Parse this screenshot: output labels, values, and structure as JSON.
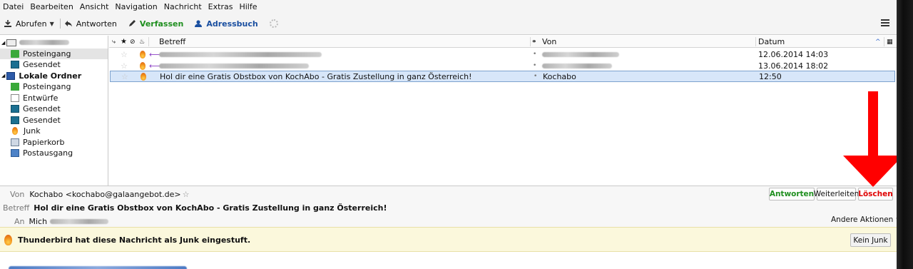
{
  "menubar": [
    "Datei",
    "Bearbeiten",
    "Ansicht",
    "Navigation",
    "Nachricht",
    "Extras",
    "Hilfe"
  ],
  "toolbar": {
    "get": "Abrufen",
    "reply": "Antworten",
    "compose": "Verfassen",
    "addressbook": "Adressbuch"
  },
  "folders": {
    "local_folders": "Lokale Ordner",
    "account_items": [
      {
        "label": "Posteingang",
        "icon": "inbox-icon"
      },
      {
        "label": "Gesendet",
        "icon": "sent-icon"
      }
    ],
    "local_items": [
      {
        "label": "Posteingang",
        "icon": "inbox-icon"
      },
      {
        "label": "Entwürfe",
        "icon": "drafts-icon"
      },
      {
        "label": "Gesendet",
        "icon": "sent-icon"
      },
      {
        "label": "Gesendet",
        "icon": "sent-icon"
      },
      {
        "label": "Junk",
        "icon": "junk-icon"
      },
      {
        "label": "Papierkorb",
        "icon": "trash-icon"
      },
      {
        "label": "Postausgang",
        "icon": "outbox-icon"
      }
    ]
  },
  "columns": {
    "subject": "Betreff",
    "from": "Von",
    "date": "Datum"
  },
  "messages": [
    {
      "subject": "",
      "from": "",
      "date": "12.06.2014 14:03"
    },
    {
      "subject": "",
      "from": "",
      "date": "13.06.2014 18:02"
    },
    {
      "subject": "Hol dir eine Gratis Obstbox von KochAbo - Gratis Zustellung in ganz Österreich!",
      "from": "Kochabo",
      "date": "12:50"
    }
  ],
  "header": {
    "from_label": "Von",
    "from_value": "Kochabo <kochabo@galaangebot.de>",
    "subject_label": "Betreff",
    "subject_value": "Hol dir eine Gratis Obstbox von KochAbo - Gratis Zustellung in ganz Österreich!",
    "to_label": "An",
    "to_value": "Mich",
    "btn_reply": "Antworten",
    "btn_forward": "Weiterleiten",
    "btn_delete": "Löschen",
    "other_actions": "Andere Aktionen"
  },
  "junkbar": {
    "text": "Thunderbird hat diese Nachricht als Junk eingestuft.",
    "button": "Kein Junk"
  },
  "colors": {
    "green": "#1f8f1f",
    "blue": "#1a4fa0",
    "red": "#e00000",
    "selection": "#d7e6f9"
  }
}
